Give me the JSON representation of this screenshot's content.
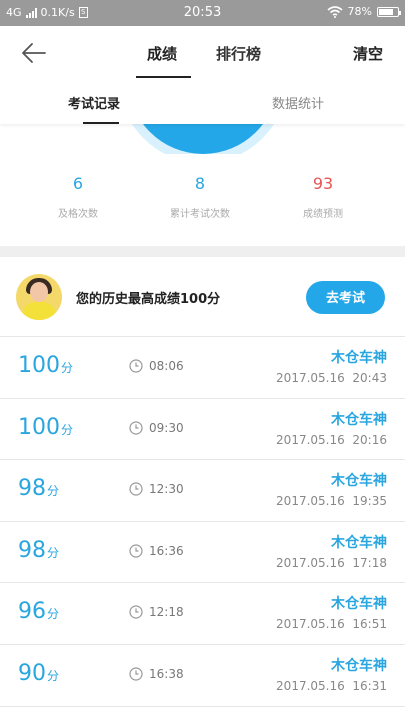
{
  "status_bar": {
    "network": "4G",
    "speed": "0.1K/s",
    "time": "20:53",
    "battery": "78%",
    "battery_level": 0.78
  },
  "header": {
    "tabs": [
      {
        "label": "成绩",
        "active": true
      },
      {
        "label": "排行榜",
        "active": false
      }
    ],
    "clear_label": "清空"
  },
  "sub_tabs": [
    {
      "label": "考试记录",
      "active": true
    },
    {
      "label": "数据统计",
      "active": false
    }
  ],
  "stats": [
    {
      "value": "6",
      "label": "及格次数"
    },
    {
      "value": "8",
      "label": "累计考试次数"
    },
    {
      "value": "93",
      "label": "成绩预测"
    }
  ],
  "best": {
    "text": "您的历史最高成绩100分",
    "button": "去考试"
  },
  "records": [
    {
      "score": "100",
      "unit": "分",
      "duration": "08:06",
      "user": "木仓车神",
      "date": "2017.05.16",
      "time": "20:43"
    },
    {
      "score": "100",
      "unit": "分",
      "duration": "09:30",
      "user": "木仓车神",
      "date": "2017.05.16",
      "time": "20:16"
    },
    {
      "score": "98",
      "unit": "分",
      "duration": "12:30",
      "user": "木仓车神",
      "date": "2017.05.16",
      "time": "19:35"
    },
    {
      "score": "98",
      "unit": "分",
      "duration": "16:36",
      "user": "木仓车神",
      "date": "2017.05.16",
      "time": "17:18"
    },
    {
      "score": "96",
      "unit": "分",
      "duration": "12:18",
      "user": "木仓车神",
      "date": "2017.05.16",
      "time": "16:51"
    },
    {
      "score": "90",
      "unit": "分",
      "duration": "16:38",
      "user": "木仓车神",
      "date": "2017.05.16",
      "time": "16:31"
    }
  ],
  "colors": {
    "accent": "#24a7e8",
    "prediction": "#e85555"
  }
}
